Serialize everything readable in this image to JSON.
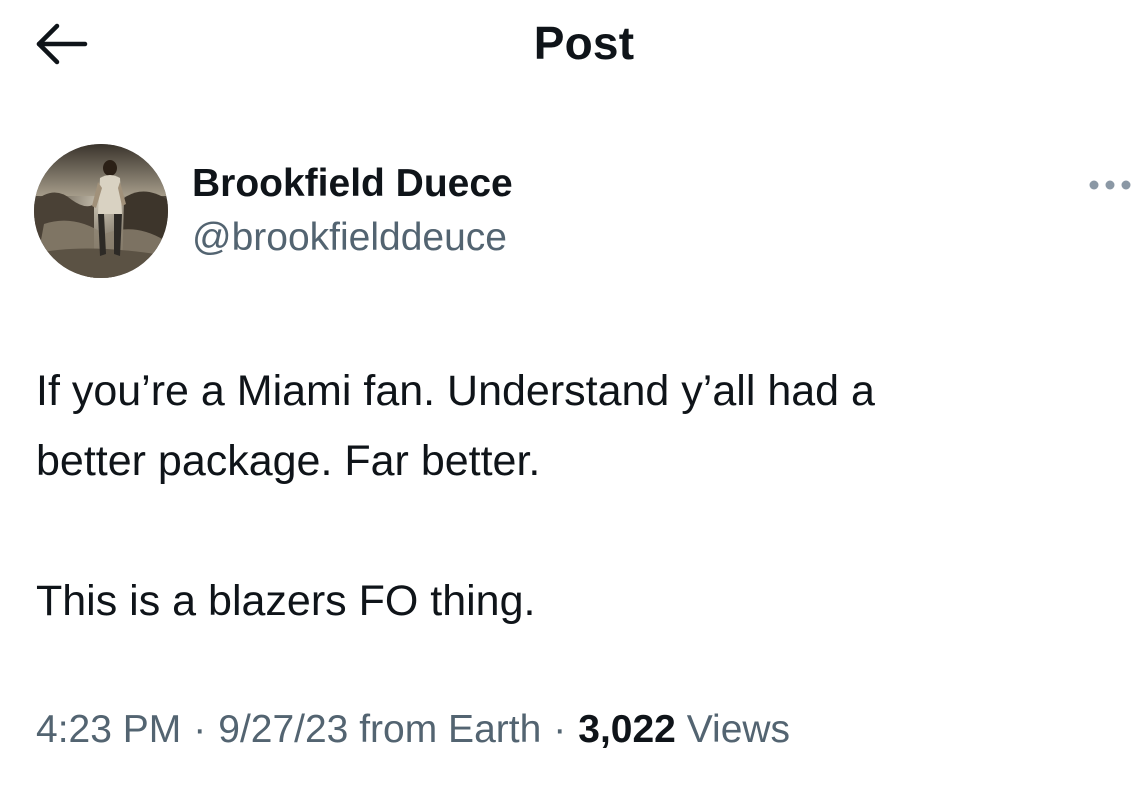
{
  "header": {
    "title": "Post",
    "back_icon": "arrow-left-icon"
  },
  "author": {
    "display_name": "Brookfield Duece",
    "handle": "@brookfielddeuce",
    "more_icon": "more-horizontal-icon"
  },
  "tweet": {
    "lines": [
      "If you’re a Miami fan. Understand y’all had a",
      "better package. Far better.",
      "",
      "This is a blazers FO thing."
    ]
  },
  "meta": {
    "time": "4:23 PM",
    "date": "9/27/23",
    "source": "from Earth",
    "separator": "·",
    "views_count": "3,022",
    "views_label": "Views"
  },
  "colors": {
    "text_primary": "#0f1419",
    "text_secondary": "#536471",
    "background": "#ffffff",
    "more_dots": "#8b98a5"
  }
}
